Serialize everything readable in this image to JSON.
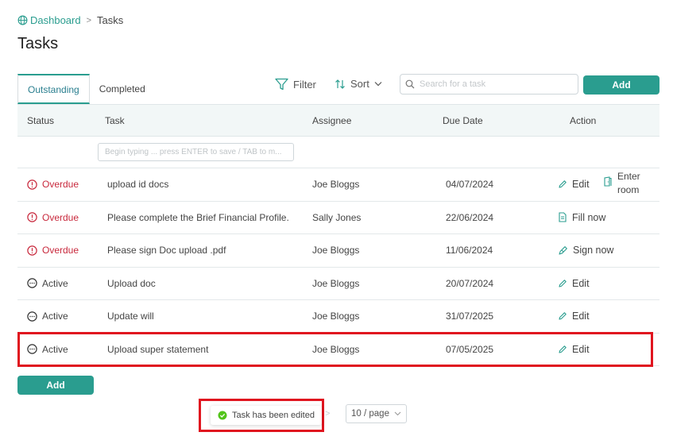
{
  "breadcrumb": {
    "home": "Dashboard",
    "separator": ">",
    "current": "Tasks"
  },
  "page_title": "Tasks",
  "tabs": [
    {
      "label": "Outstanding",
      "active": true
    },
    {
      "label": "Completed",
      "active": false
    }
  ],
  "toolbar": {
    "filter_label": "Filter",
    "sort_label": "Sort",
    "search_placeholder": "Search for a task",
    "add_label": "Add"
  },
  "table": {
    "headers": {
      "status": "Status",
      "task": "Task",
      "assignee": "Assignee",
      "due_date": "Due Date",
      "action": "Action"
    },
    "new_task_placeholder": "Begin typing ... press ENTER to save / TAB to m...",
    "rows": [
      {
        "status": "Overdue",
        "task": "upload id docs",
        "assignee": "Joe Bloggs",
        "due": "04/07/2024",
        "action": "Edit",
        "action2_line1": "Enter",
        "action2_line2": "room"
      },
      {
        "status": "Overdue",
        "task": "Please complete the Brief Financial Profile.",
        "assignee": "Sally Jones",
        "due": "22/06/2024",
        "action": "Fill now"
      },
      {
        "status": "Overdue",
        "task": "Please sign Doc upload .pdf",
        "assignee": "Joe Bloggs",
        "due": "11/06/2024",
        "action": "Sign now"
      },
      {
        "status": "Active",
        "task": "Upload doc",
        "assignee": "Joe Bloggs",
        "due": "20/07/2024",
        "action": "Edit"
      },
      {
        "status": "Active",
        "task": "Update will",
        "assignee": "Joe Bloggs",
        "due": "31/07/2025",
        "action": "Edit"
      },
      {
        "status": "Active",
        "task": "Upload super statement",
        "assignee": "Joe Bloggs",
        "due": "07/05/2025",
        "action": "Edit"
      }
    ]
  },
  "bottom_add_label": "Add",
  "toast": {
    "message": "Task has been edited"
  },
  "pagination": {
    "page_size": "10 / page"
  },
  "colors": {
    "accent": "#2a9d8f",
    "overdue": "#c8283c",
    "success": "#52c41a",
    "highlight": "#e0151f"
  }
}
